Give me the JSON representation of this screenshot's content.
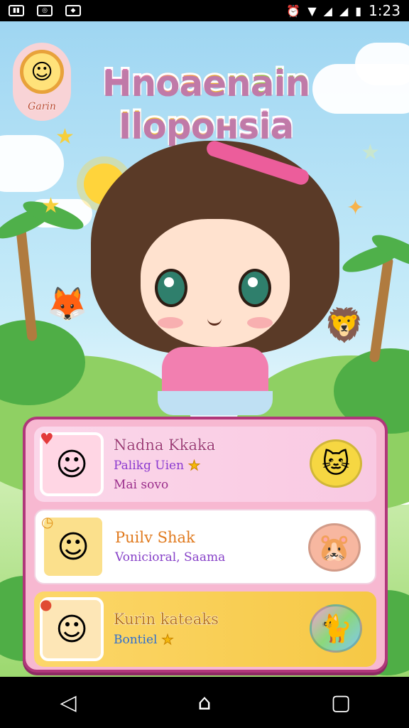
{
  "status_bar": {
    "left_icons": [
      "sim-icon",
      "app-icon",
      "bag-icon"
    ],
    "icons_right": [
      "alarm-icon",
      "wifi-icon",
      "signal-icon",
      "signal-icon",
      "battery-icon"
    ],
    "time": "1:23"
  },
  "avatar": {
    "name": "Garin"
  },
  "title": {
    "line1": "Hnoaenain",
    "line2": "Ilopонsia"
  },
  "list": [
    {
      "name": "Nadna Kkaka",
      "line1": "Palikg Uien",
      "line2": "Mai sovo",
      "badge": "heart-icon"
    },
    {
      "name": "Puilv Shak",
      "line1": "Vonicioral, Saama",
      "badge": "clock-icon"
    },
    {
      "name": "Kurin kateaks",
      "line1": "Bontiel",
      "badge": "apple-icon"
    }
  ],
  "nav": [
    "back-icon",
    "home-icon",
    "recents-icon"
  ]
}
